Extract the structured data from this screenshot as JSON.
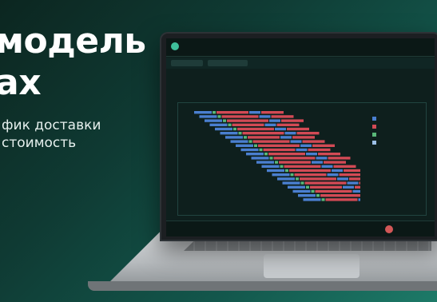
{
  "headline": {
    "line1": "модель",
    "line2": "ах"
  },
  "subtitle": {
    "line1": "фик доставки",
    "line2": "стоимость"
  },
  "colors": {
    "accent": "#3fbf9b",
    "bar_blue": "#4a7fd0",
    "bar_red": "#d24a55",
    "bar_green": "#59b879",
    "bar_light": "#9cc0e6"
  }
}
